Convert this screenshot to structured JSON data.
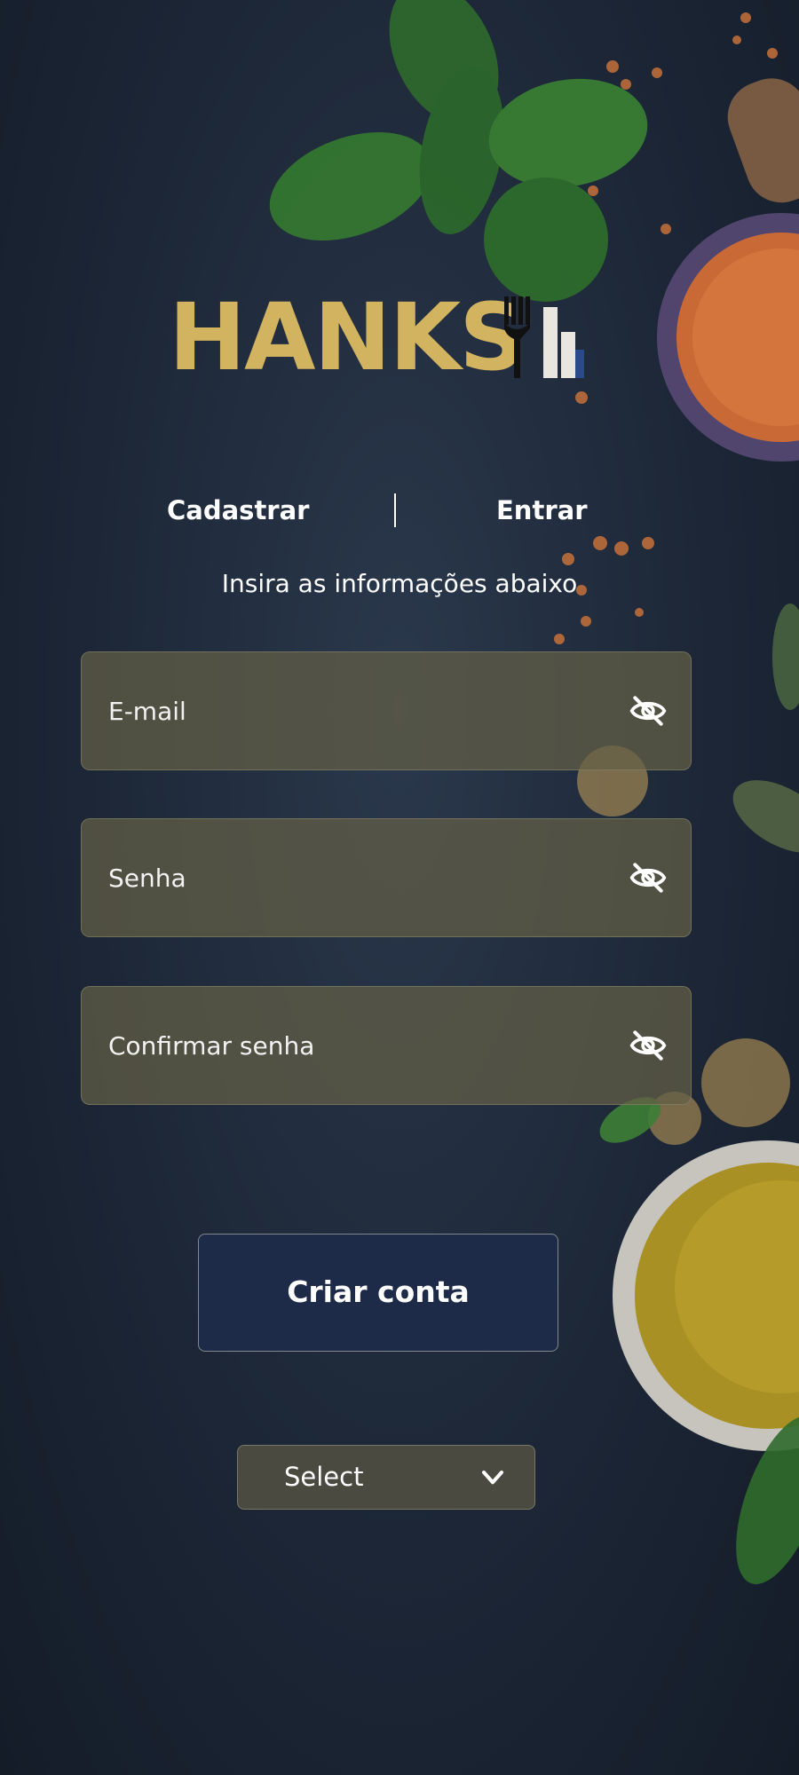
{
  "brand": {
    "logo_text": "HANKS",
    "logo_color": "#d2b35f"
  },
  "tabs": [
    {
      "label": "Cadastrar",
      "active": true
    },
    {
      "label": "Entrar",
      "active": false
    }
  ],
  "subtitle": "Insira as informações abaixo",
  "form": {
    "email_placeholder": "E-mail",
    "password_placeholder": "Senha",
    "confirm_placeholder": "Confirmar senha",
    "visibility_icon": "eye-off-icon"
  },
  "submit_label": "Criar conta",
  "select": {
    "value": "Select",
    "icon": "chevron-down-icon"
  },
  "colors": {
    "background": "#1f2b3c",
    "button": "#1d2a48",
    "field": "#645f46"
  }
}
